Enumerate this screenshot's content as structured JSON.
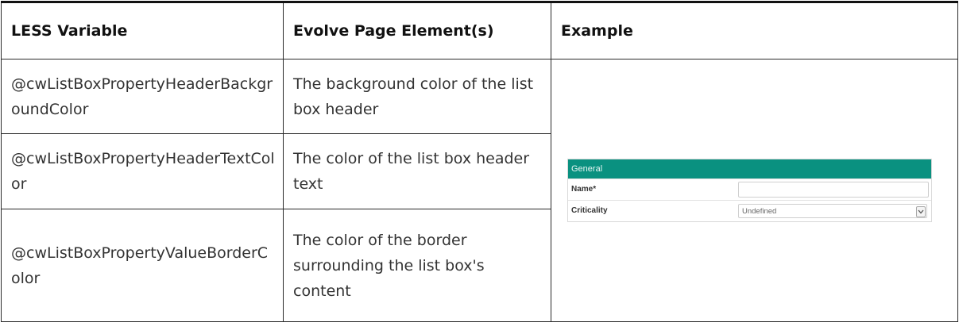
{
  "table": {
    "headers": {
      "col1": "LESS Variable",
      "col2": "Evolve Page Element(s)",
      "col3": "Example"
    },
    "rows": [
      {
        "variable": "@cwListBoxPropertyHeaderBackgroundColor",
        "element": "The background color of the list box header"
      },
      {
        "variable": "@cwListBoxPropertyHeaderTextColor",
        "element": "The color of the list box header text"
      },
      {
        "variable": "@cwListBoxPropertyValueBorderColor",
        "element": "The color of the border surrounding the list box's content"
      }
    ]
  },
  "example": {
    "header_title": "General",
    "fields": [
      {
        "label": "Name*",
        "value": ""
      },
      {
        "label": "Criticality",
        "value": "Undefined"
      }
    ],
    "colors": {
      "header_background": "#0a9180",
      "header_text": "#e8f7f4",
      "value_border": "#cfcfcf"
    },
    "icons": {
      "select_toggle": "chevron-down-icon"
    }
  }
}
